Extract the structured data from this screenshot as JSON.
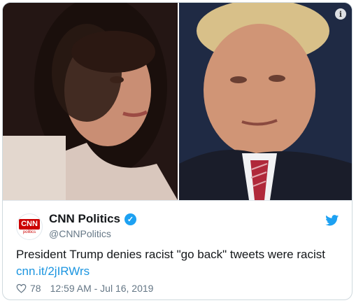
{
  "tweet": {
    "author_name": "CNN Politics",
    "author_handle": "@CNNPolitics",
    "avatar_text": "CNN",
    "avatar_sub": "politics",
    "text": "President Trump denies racist \"go back\" tweets were racist",
    "link": "cnn.it/2jIRWrs",
    "like_count": "78",
    "timestamp": "12:59 AM - Jul 16, 2019",
    "info_glyph": "i"
  },
  "icons": {
    "verified": "verified-badge-icon",
    "platform": "bird-icon",
    "like": "heart-icon",
    "info": "info-icon"
  },
  "colors": {
    "link": "#1b95e0",
    "verified": "#1da1f2",
    "brand": "#cc0000",
    "secondary_text": "#657786"
  }
}
